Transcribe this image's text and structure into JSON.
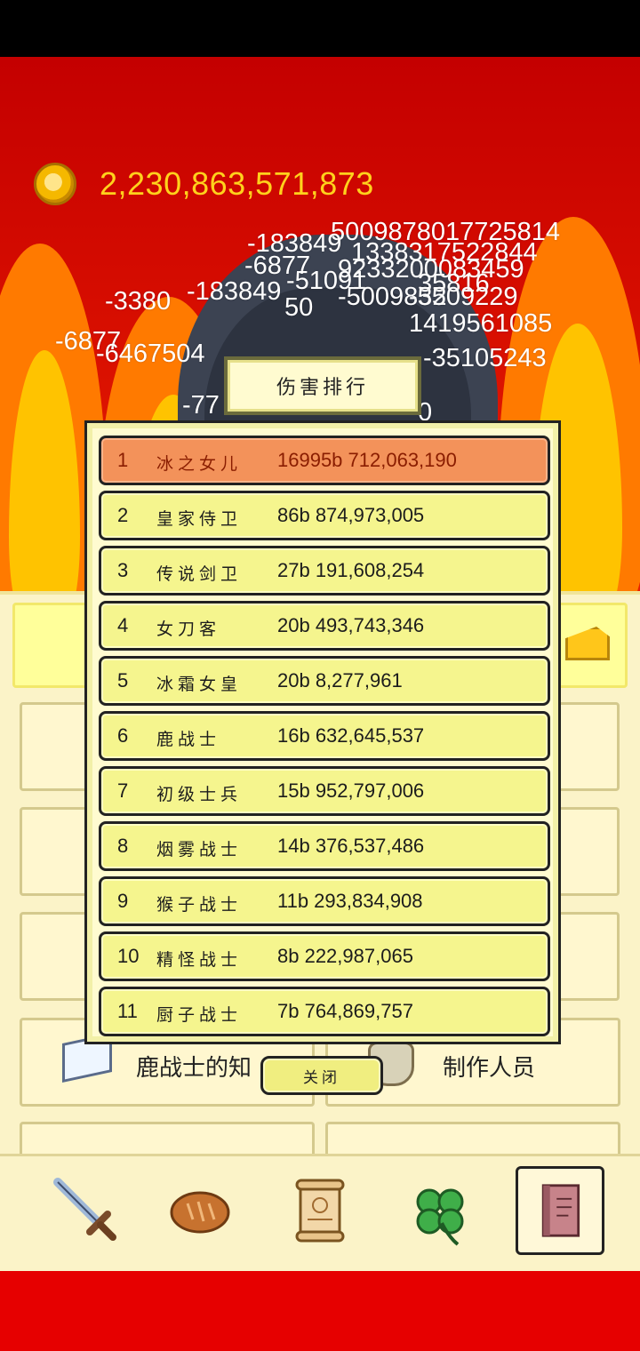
{
  "hud": {
    "gold": "2,230,863,571,873"
  },
  "damage_numbers": [
    "5009878017725814",
    "-183849",
    "1338317522844",
    "-6877",
    "9233200083459",
    "-51091",
    "35816",
    "-3380",
    "-183849",
    "50",
    "-5009832",
    "-5509229",
    "1419561085",
    "-6877",
    "-35105243",
    "-6467504",
    "-77",
    "0"
  ],
  "ranking": {
    "title": "伤害排行",
    "rows": [
      {
        "rank": "1",
        "name": "冰之女儿",
        "score": "16995b 712,063,190"
      },
      {
        "rank": "2",
        "name": "皇家侍卫",
        "score": "86b 874,973,005"
      },
      {
        "rank": "3",
        "name": "传说剑卫",
        "score": "27b 191,608,254"
      },
      {
        "rank": "4",
        "name": "女刀客",
        "score": "20b 493,743,346"
      },
      {
        "rank": "5",
        "name": "冰霜女皇",
        "score": "20b 8,277,961"
      },
      {
        "rank": "6",
        "name": "鹿战士",
        "score": "16b 632,645,537"
      },
      {
        "rank": "7",
        "name": "初级士兵",
        "score": "15b 952,797,006"
      },
      {
        "rank": "8",
        "name": "烟雾战士",
        "score": "14b 376,537,486"
      },
      {
        "rank": "9",
        "name": "猴子战士",
        "score": "11b 293,834,908"
      },
      {
        "rank": "10",
        "name": "精怪战士",
        "score": "8b 222,987,065"
      },
      {
        "rank": "11",
        "name": "厨子战士",
        "score": "7b 764,869,757"
      }
    ],
    "close_label": "关闭"
  },
  "menu": {
    "knowledge_label": "鹿战士的知",
    "credits_label": "制作人员"
  },
  "nav": {
    "items": [
      "sword",
      "bread",
      "scroll",
      "clover",
      "book"
    ],
    "active": "book"
  },
  "colors": {
    "gold_text": "#ffd21c",
    "highlight_row": "#f3925a",
    "row": "#f5f58e"
  }
}
